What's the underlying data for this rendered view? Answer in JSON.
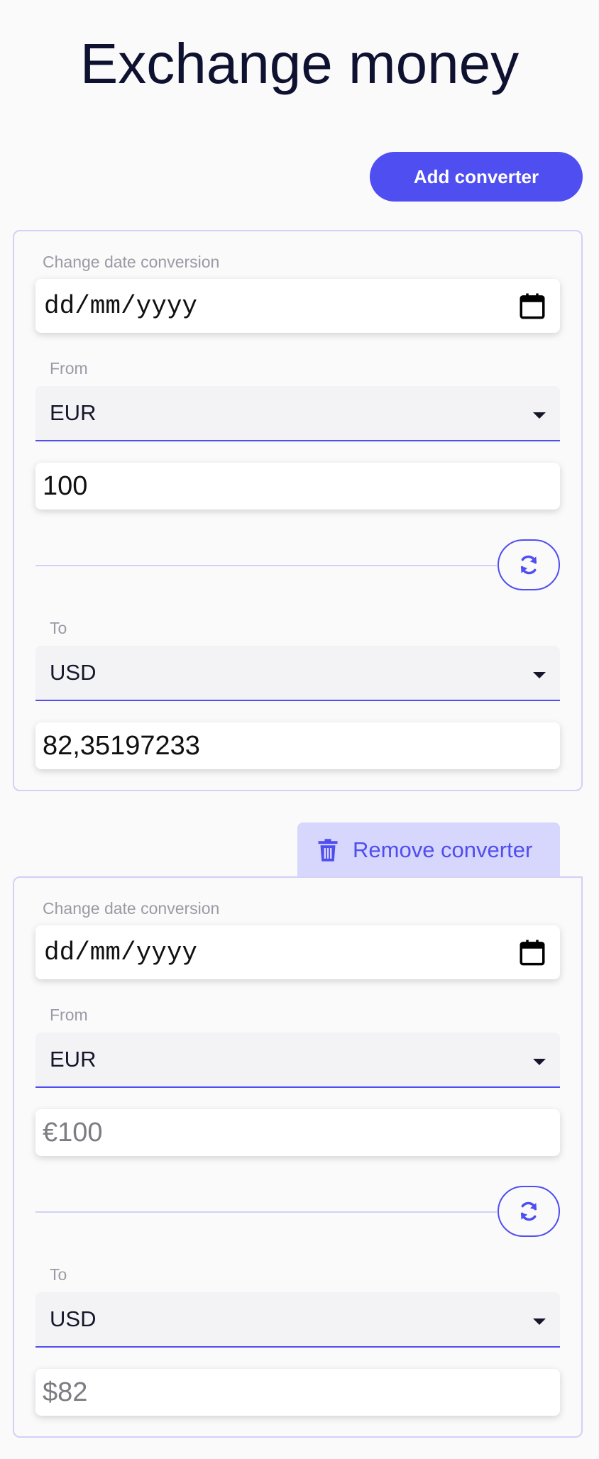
{
  "page": {
    "title": "Exchange money",
    "add_converter_label": "Add converter",
    "remove_converter_label": "Remove converter"
  },
  "colors": {
    "accent": "#4f4ef0",
    "accent_soft": "#d7d6fc",
    "border": "#d2d1f6",
    "background": "#fafafb",
    "label_gray": "#9a9aa4"
  },
  "converters": [
    {
      "date_label": "Change date conversion",
      "date_placeholder": "dd/mm/yyyy",
      "from_label": "From",
      "from_currency": "EUR",
      "from_amount_value": "100",
      "from_amount_placeholder": "",
      "to_label": "To",
      "to_currency": "USD",
      "to_amount_value": "82,35197233",
      "to_amount_placeholder": ""
    },
    {
      "date_label": "Change date conversion",
      "date_placeholder": "dd/mm/yyyy",
      "from_label": "From",
      "from_currency": "EUR",
      "from_amount_value": "",
      "from_amount_placeholder": "€100",
      "to_label": "To",
      "to_currency": "USD",
      "to_amount_value": "",
      "to_amount_placeholder": "$82"
    }
  ],
  "icons": {
    "calendar": "calendar-icon",
    "swap": "swap-icon",
    "trash": "trash-icon",
    "caret": "chevron-down-icon"
  }
}
